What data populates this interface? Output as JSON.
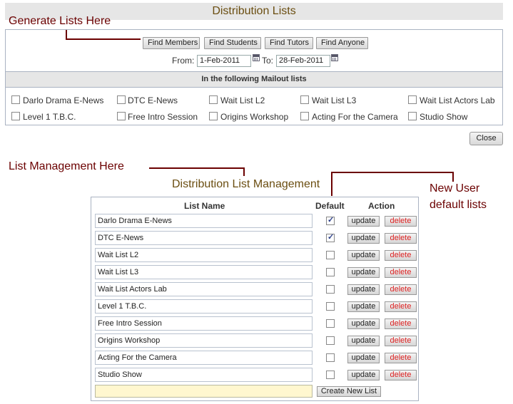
{
  "window": {
    "title": "Distribution Lists"
  },
  "annotations": {
    "generate": "Generate Lists Here",
    "management": "List Management Here",
    "new_user_line1": "New User",
    "new_user_line2": "default lists"
  },
  "find_buttons": [
    {
      "label": "Find Members"
    },
    {
      "label": "Find Students"
    },
    {
      "label": "Find Tutors"
    },
    {
      "label": "Find Anyone"
    }
  ],
  "date_range": {
    "from_label": "From:",
    "from_value": "1-Feb-2011",
    "to_label": "To:",
    "to_value": "28-Feb-2011"
  },
  "mailout": {
    "header": "In the following Mailout lists",
    "lists": [
      {
        "label": "Darlo Drama E-News",
        "checked": false
      },
      {
        "label": "DTC E-News",
        "checked": false
      },
      {
        "label": "Wait List L2",
        "checked": false
      },
      {
        "label": "Wait List L3",
        "checked": false
      },
      {
        "label": "Wait List Actors Lab",
        "checked": false
      },
      {
        "label": "Level 1 T.B.C.",
        "checked": false
      },
      {
        "label": "Free Intro Session",
        "checked": false
      },
      {
        "label": "Origins Workshop",
        "checked": false
      },
      {
        "label": "Acting For the Camera",
        "checked": false
      },
      {
        "label": "Studio Show",
        "checked": false
      }
    ]
  },
  "close_label": "Close",
  "management": {
    "title": "Distribution List Management",
    "columns": {
      "name": "List Name",
      "default": "Default",
      "action": "Action"
    },
    "update_label": "update",
    "delete_label": "delete",
    "rows": [
      {
        "name": "Darlo Drama E-News",
        "default": true
      },
      {
        "name": "DTC E-News",
        "default": true
      },
      {
        "name": "Wait List L2",
        "default": false
      },
      {
        "name": "Wait List L3",
        "default": false
      },
      {
        "name": "Wait List Actors Lab",
        "default": false
      },
      {
        "name": "Level 1 T.B.C.",
        "default": false
      },
      {
        "name": "Free Intro Session",
        "default": false
      },
      {
        "name": "Origins Workshop",
        "default": false
      },
      {
        "name": "Acting For the Camera",
        "default": false
      },
      {
        "name": "Studio Show",
        "default": false
      }
    ],
    "new_list_value": "",
    "create_label": "Create New List"
  },
  "colors": {
    "title_text": "#6b4e11",
    "annotation": "#6b0000",
    "delete_text": "#dd2222",
    "new_input_bg": "#fff7cf"
  }
}
